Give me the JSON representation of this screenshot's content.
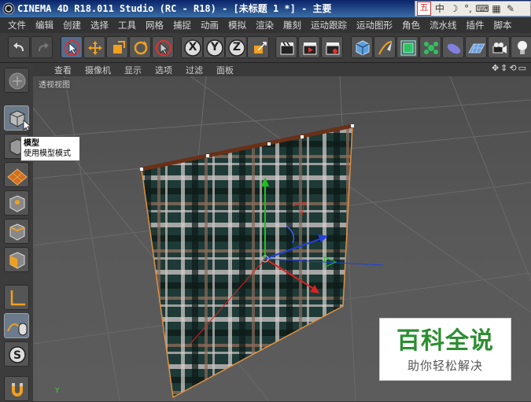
{
  "window": {
    "title": "CINEMA 4D R18.011 Studio (RC - R18) - [未标题 1 *] - 主要"
  },
  "ime_bar": {
    "logo": "五",
    "mode": "中",
    "items": [
      "moon-icon",
      "quote-icon",
      "keyboard-icon",
      "grid-icon",
      "wrench-icon"
    ]
  },
  "menu": {
    "items": [
      "文件",
      "编辑",
      "创建",
      "选择",
      "工具",
      "网格",
      "捕捉",
      "动画",
      "模拟",
      "渲染",
      "雕刻",
      "运动跟踪",
      "运动图形",
      "角色",
      "流水线",
      "插件",
      "脚本"
    ]
  },
  "view_menu": {
    "items": [
      "查看",
      "摄像机",
      "显示",
      "选项",
      "过滤",
      "面板"
    ]
  },
  "viewport": {
    "label": "透视视图",
    "axis_y_label": "Y"
  },
  "tooltip": {
    "title": "模型",
    "description": "使用模型模式"
  },
  "watermark": {
    "logo": "百科全说",
    "tagline": "助你轻松解决"
  },
  "toolbar": {
    "x_label": "X",
    "y_label": "Y",
    "z_label": "Z"
  },
  "colors": {
    "accent_orange": "#f0a020",
    "axis_x": "#e02020",
    "axis_y": "#20c020",
    "axis_z": "#2040e0",
    "cloth_dark": "#1e3a36"
  }
}
